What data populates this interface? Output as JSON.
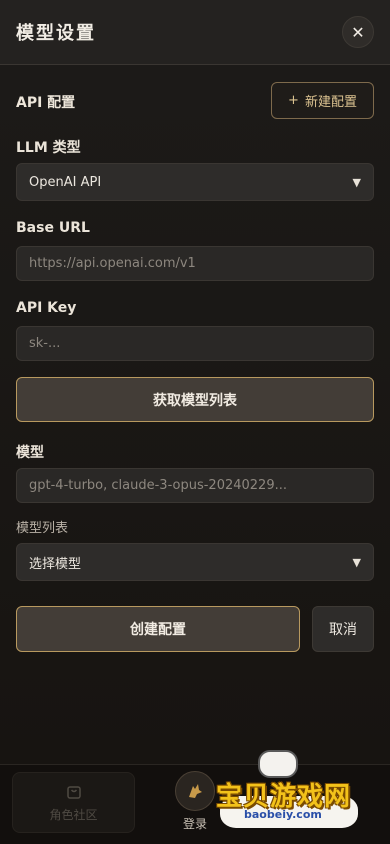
{
  "header": {
    "title": "模型设置",
    "close_icon": "close-icon"
  },
  "api_config": {
    "title": "API 配置",
    "new_button": "新建配置",
    "new_icon": "plus-icon"
  },
  "llm_type": {
    "label": "LLM 类型",
    "value": "OpenAI API"
  },
  "base_url": {
    "label": "Base URL",
    "placeholder": "https://api.openai.com/v1"
  },
  "api_key": {
    "label": "API Key",
    "placeholder": "sk-..."
  },
  "fetch_button": "获取模型列表",
  "model": {
    "label": "模型",
    "placeholder": "gpt-4-turbo, claude-3-opus-20240229..."
  },
  "model_list": {
    "label": "模型列表",
    "value": "选择模型"
  },
  "actions": {
    "create": "创建配置",
    "cancel": "取消"
  },
  "bottom_nav": {
    "community": {
      "label": "角色社区",
      "icon": "bag-icon"
    },
    "login": {
      "label": "登录",
      "icon": "avatar-icon"
    }
  },
  "watermark": {
    "text": "宝贝游戏网",
    "domain": "baobeiy.com"
  },
  "colors": {
    "accent": "#b8995f",
    "background": "#181512",
    "surface": "#2a2826"
  }
}
